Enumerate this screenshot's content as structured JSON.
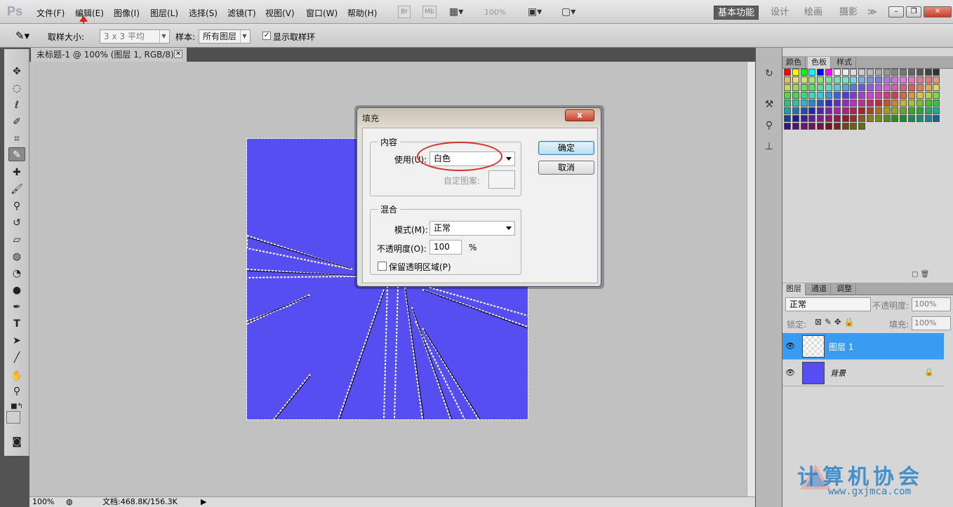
{
  "app": {
    "logo": "Ps",
    "zoom_label": "100%"
  },
  "menu": [
    "文件(F)",
    "编辑(E)",
    "图像(I)",
    "图层(L)",
    "选择(S)",
    "滤镜(T)",
    "视图(V)",
    "窗口(W)",
    "帮助(H)"
  ],
  "menu_extra": {
    "br": "Br",
    "mb": "Mb",
    "zoom": "100%"
  },
  "workspaces": [
    "基本功能",
    "设计",
    "绘画",
    "摄影"
  ],
  "workspace_more": "≫",
  "options": {
    "sample_size_label": "取样大小:",
    "sample_size_value": "3 x 3 平均",
    "sample_label": "样本:",
    "sample_value": "所有图层",
    "show_ring_label": "显示取样环",
    "show_ring_checked": "✓"
  },
  "document": {
    "tab_title": "未标题-1 @ 100% (图层 1, RGB/8) *",
    "close": "✕"
  },
  "status": {
    "zoom": "100%",
    "doc_size": "文档:468.8K/156.3K"
  },
  "panels": {
    "color_tabs": [
      "颜色",
      "色板",
      "样式"
    ],
    "layers_tabs": [
      "图层",
      "通道",
      "调整"
    ],
    "blend_mode": "正常",
    "opacity_label": "不透明度:",
    "opacity_value": "100%",
    "lock_label": "锁定:",
    "fill_label": "填充:",
    "fill_value": "100%",
    "layers": [
      {
        "name": "图层 1",
        "selected": true
      },
      {
        "name": "背景",
        "locked": true
      }
    ]
  },
  "dialog": {
    "title": "填充",
    "close": "x",
    "contents_group": "内容",
    "use_label": "使用(U):",
    "use_value": "白色",
    "custom_pattern_label": "自定图案:",
    "blending_group": "混合",
    "mode_label": "模式(M):",
    "mode_value": "正常",
    "opacity_label": "不透明度(O):",
    "opacity_value": "100",
    "percent": "%",
    "preserve_label": "保留透明区域(P)",
    "ok": "确定",
    "cancel": "取消"
  },
  "watermark": {
    "text": "计算机协会",
    "url": "www.gxjmca.com"
  },
  "colors": {
    "artwork": "#574ef2",
    "accent": "#3a9bf2",
    "annotation": "#d9302a"
  },
  "icons": [
    "eyedropper-icon",
    "move-icon",
    "marquee-icon",
    "lasso-icon",
    "quick-select-icon",
    "crop-icon",
    "brush-icon",
    "eye-icon",
    "lock-icon"
  ]
}
